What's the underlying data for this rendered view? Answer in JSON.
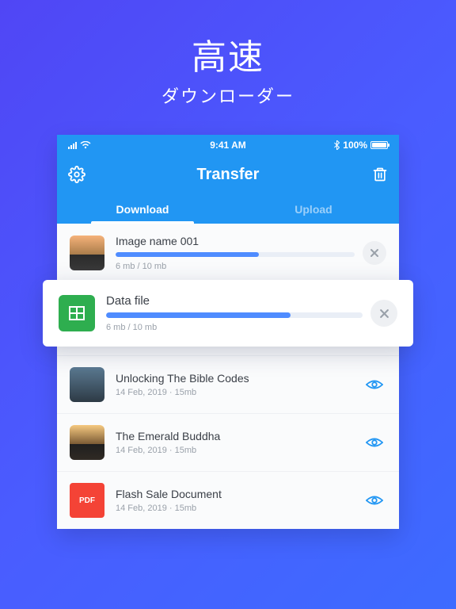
{
  "promo": {
    "title": "高速",
    "subtitle": "ダウンローダー"
  },
  "statusbar": {
    "time": "9:41 AM",
    "battery": "100%"
  },
  "nav": {
    "title": "Transfer"
  },
  "tabs": {
    "download": "Download",
    "upload": "Upload"
  },
  "items": [
    {
      "title": "Image name 001",
      "meta": "6 mb / 10 mb",
      "progress": 60,
      "kind": "progress",
      "thumb": "img1"
    },
    {
      "title": "Data file",
      "meta": "6 mb / 10 mb",
      "progress": 72,
      "kind": "progress-elevated",
      "thumb": "sheet"
    },
    {
      "title": "Unlocking The Bible Codes",
      "meta": "14 Feb, 2019 · 15mb",
      "kind": "done",
      "thumb": "img3"
    },
    {
      "title": "The Emerald Buddha",
      "meta": "14 Feb, 2019 · 15mb",
      "kind": "done",
      "thumb": "img4"
    },
    {
      "title": "Flash Sale Document",
      "meta": "14 Feb, 2019 · 15mb",
      "kind": "done",
      "thumb": "pdf",
      "thumb_label": "PDF"
    }
  ]
}
